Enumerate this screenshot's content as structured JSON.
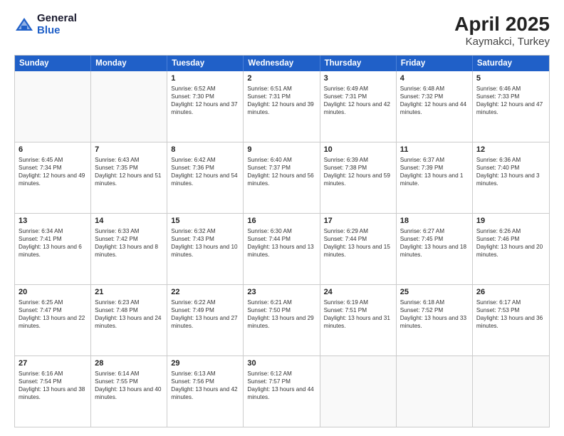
{
  "logo": {
    "general": "General",
    "blue": "Blue"
  },
  "title": "April 2025",
  "location": "Kaymakci, Turkey",
  "weekdays": [
    "Sunday",
    "Monday",
    "Tuesday",
    "Wednesday",
    "Thursday",
    "Friday",
    "Saturday"
  ],
  "weeks": [
    [
      {
        "day": "",
        "info": ""
      },
      {
        "day": "",
        "info": ""
      },
      {
        "day": "1",
        "info": "Sunrise: 6:52 AM\nSunset: 7:30 PM\nDaylight: 12 hours and 37 minutes."
      },
      {
        "day": "2",
        "info": "Sunrise: 6:51 AM\nSunset: 7:31 PM\nDaylight: 12 hours and 39 minutes."
      },
      {
        "day": "3",
        "info": "Sunrise: 6:49 AM\nSunset: 7:31 PM\nDaylight: 12 hours and 42 minutes."
      },
      {
        "day": "4",
        "info": "Sunrise: 6:48 AM\nSunset: 7:32 PM\nDaylight: 12 hours and 44 minutes."
      },
      {
        "day": "5",
        "info": "Sunrise: 6:46 AM\nSunset: 7:33 PM\nDaylight: 12 hours and 47 minutes."
      }
    ],
    [
      {
        "day": "6",
        "info": "Sunrise: 6:45 AM\nSunset: 7:34 PM\nDaylight: 12 hours and 49 minutes."
      },
      {
        "day": "7",
        "info": "Sunrise: 6:43 AM\nSunset: 7:35 PM\nDaylight: 12 hours and 51 minutes."
      },
      {
        "day": "8",
        "info": "Sunrise: 6:42 AM\nSunset: 7:36 PM\nDaylight: 12 hours and 54 minutes."
      },
      {
        "day": "9",
        "info": "Sunrise: 6:40 AM\nSunset: 7:37 PM\nDaylight: 12 hours and 56 minutes."
      },
      {
        "day": "10",
        "info": "Sunrise: 6:39 AM\nSunset: 7:38 PM\nDaylight: 12 hours and 59 minutes."
      },
      {
        "day": "11",
        "info": "Sunrise: 6:37 AM\nSunset: 7:39 PM\nDaylight: 13 hours and 1 minute."
      },
      {
        "day": "12",
        "info": "Sunrise: 6:36 AM\nSunset: 7:40 PM\nDaylight: 13 hours and 3 minutes."
      }
    ],
    [
      {
        "day": "13",
        "info": "Sunrise: 6:34 AM\nSunset: 7:41 PM\nDaylight: 13 hours and 6 minutes."
      },
      {
        "day": "14",
        "info": "Sunrise: 6:33 AM\nSunset: 7:42 PM\nDaylight: 13 hours and 8 minutes."
      },
      {
        "day": "15",
        "info": "Sunrise: 6:32 AM\nSunset: 7:43 PM\nDaylight: 13 hours and 10 minutes."
      },
      {
        "day": "16",
        "info": "Sunrise: 6:30 AM\nSunset: 7:44 PM\nDaylight: 13 hours and 13 minutes."
      },
      {
        "day": "17",
        "info": "Sunrise: 6:29 AM\nSunset: 7:44 PM\nDaylight: 13 hours and 15 minutes."
      },
      {
        "day": "18",
        "info": "Sunrise: 6:27 AM\nSunset: 7:45 PM\nDaylight: 13 hours and 18 minutes."
      },
      {
        "day": "19",
        "info": "Sunrise: 6:26 AM\nSunset: 7:46 PM\nDaylight: 13 hours and 20 minutes."
      }
    ],
    [
      {
        "day": "20",
        "info": "Sunrise: 6:25 AM\nSunset: 7:47 PM\nDaylight: 13 hours and 22 minutes."
      },
      {
        "day": "21",
        "info": "Sunrise: 6:23 AM\nSunset: 7:48 PM\nDaylight: 13 hours and 24 minutes."
      },
      {
        "day": "22",
        "info": "Sunrise: 6:22 AM\nSunset: 7:49 PM\nDaylight: 13 hours and 27 minutes."
      },
      {
        "day": "23",
        "info": "Sunrise: 6:21 AM\nSunset: 7:50 PM\nDaylight: 13 hours and 29 minutes."
      },
      {
        "day": "24",
        "info": "Sunrise: 6:19 AM\nSunset: 7:51 PM\nDaylight: 13 hours and 31 minutes."
      },
      {
        "day": "25",
        "info": "Sunrise: 6:18 AM\nSunset: 7:52 PM\nDaylight: 13 hours and 33 minutes."
      },
      {
        "day": "26",
        "info": "Sunrise: 6:17 AM\nSunset: 7:53 PM\nDaylight: 13 hours and 36 minutes."
      }
    ],
    [
      {
        "day": "27",
        "info": "Sunrise: 6:16 AM\nSunset: 7:54 PM\nDaylight: 13 hours and 38 minutes."
      },
      {
        "day": "28",
        "info": "Sunrise: 6:14 AM\nSunset: 7:55 PM\nDaylight: 13 hours and 40 minutes."
      },
      {
        "day": "29",
        "info": "Sunrise: 6:13 AM\nSunset: 7:56 PM\nDaylight: 13 hours and 42 minutes."
      },
      {
        "day": "30",
        "info": "Sunrise: 6:12 AM\nSunset: 7:57 PM\nDaylight: 13 hours and 44 minutes."
      },
      {
        "day": "",
        "info": ""
      },
      {
        "day": "",
        "info": ""
      },
      {
        "day": "",
        "info": ""
      }
    ]
  ]
}
